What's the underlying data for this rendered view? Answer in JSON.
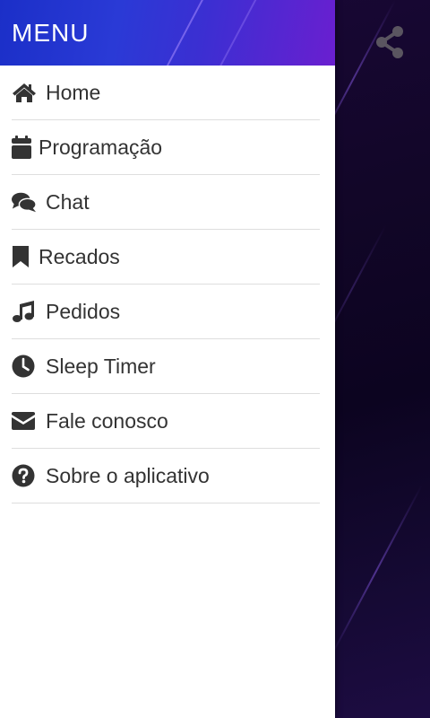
{
  "drawer": {
    "title": "MENU",
    "items": [
      {
        "label": "Home",
        "icon": "home-icon"
      },
      {
        "label": "Programação",
        "icon": "calendar-icon"
      },
      {
        "label": "Chat",
        "icon": "chat-icon"
      },
      {
        "label": "Recados",
        "icon": "bookmark-icon"
      },
      {
        "label": "Pedidos",
        "icon": "music-icon"
      },
      {
        "label": "Sleep Timer",
        "icon": "clock-icon"
      },
      {
        "label": "Fale conosco",
        "icon": "envelope-icon"
      },
      {
        "label": "Sobre o aplicativo",
        "icon": "question-circle-icon"
      }
    ]
  },
  "toolbar": {
    "share_icon": "share-icon"
  },
  "colors": {
    "header_gradient_start": "#1b2fc8",
    "header_gradient_end": "#6a1fd0",
    "icon_color": "#333333",
    "background_dark": "#120628",
    "share_icon_color": "#5a5560"
  }
}
